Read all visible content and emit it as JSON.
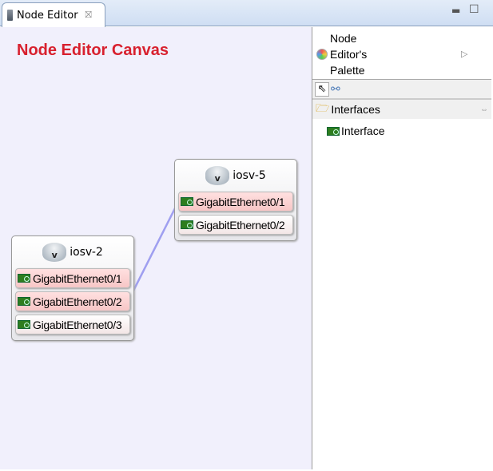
{
  "tab": {
    "title": "Node Editor",
    "close": "⛝"
  },
  "canvas": {
    "title": "Node Editor Canvas"
  },
  "nodes": [
    {
      "name": "iosv-5",
      "router_letter": "v",
      "interfaces": [
        "GigabitEthernet0/1",
        "GigabitEthernet0/2"
      ]
    },
    {
      "name": "iosv-2",
      "router_letter": "v",
      "interfaces": [
        "GigabitEthernet0/1",
        "GigabitEthernet0/2",
        "GigabitEthernet0/3"
      ]
    }
  ],
  "connection": {
    "from": "iosv-2 GigabitEthernet0/2",
    "to": "iosv-5 GigabitEthernet0/1",
    "color": "#9f9ff0"
  },
  "palette": {
    "title_lines": [
      "Node",
      "Editor's",
      "Palette"
    ],
    "drawer": "Interfaces",
    "entry": "Interface"
  }
}
